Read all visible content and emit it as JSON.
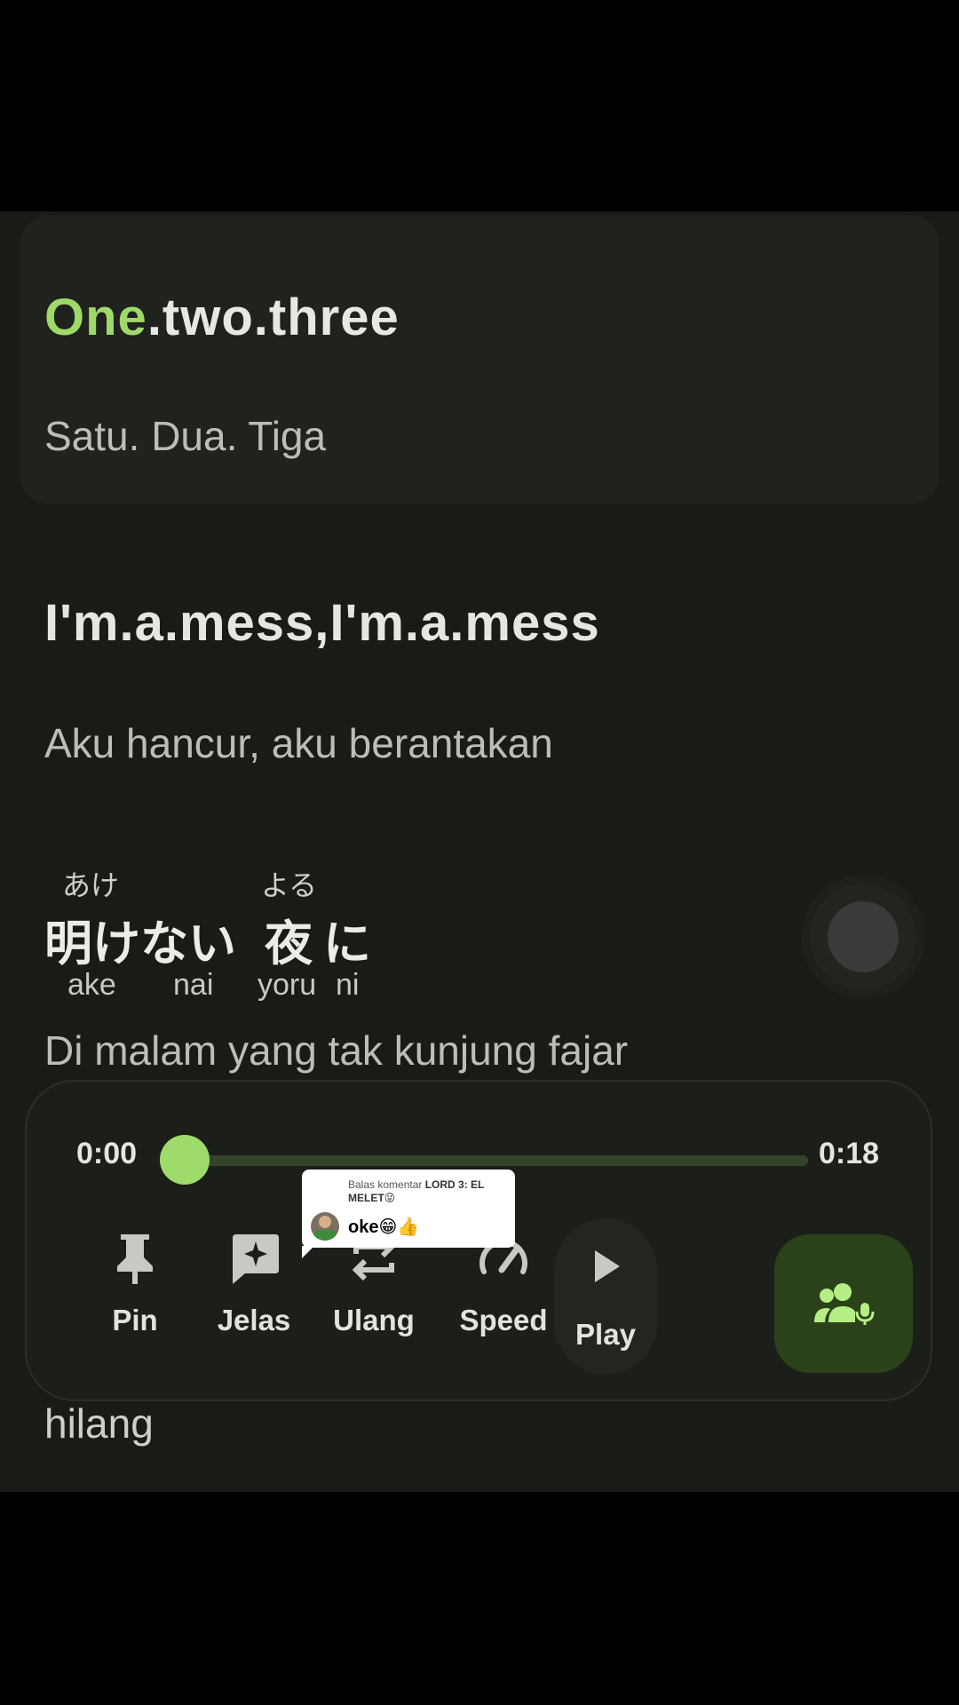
{
  "lyrics": {
    "line1": {
      "highlight": "One",
      "rest": ".two.three",
      "translation": "Satu. Dua. Tiga"
    },
    "line2": {
      "text": "I'm.a.mess,I'm.a.mess",
      "translation": "Aku hancur, aku berantakan"
    },
    "line3": {
      "tokens": [
        {
          "furigana": "あけ",
          "kanji": "明けない",
          "romaji": "ake"
        },
        {
          "furigana": "",
          "kanji": "",
          "romaji": "nai"
        },
        {
          "furigana": "よる",
          "kanji": "夜",
          "romaji": "yoru"
        },
        {
          "furigana": "",
          "kanji": "に",
          "romaji": "ni"
        }
      ],
      "translation": "Di malam yang tak kunjung fajar"
    },
    "line4": {
      "translation": "hilang"
    }
  },
  "player": {
    "current_time": "0:00",
    "total_time": "0:18",
    "progress": 0.0,
    "accent_color": "#9edb6a",
    "controls": {
      "pin": {
        "label": "Pin",
        "icon": "pin-icon"
      },
      "explain": {
        "label": "Jelas",
        "icon": "sparkle-comment-icon"
      },
      "repeat": {
        "label": "Ulang",
        "icon": "repeat-icon"
      },
      "speed": {
        "label": "Speed",
        "icon": "speedometer-icon"
      },
      "play": {
        "label": "Play",
        "icon": "play-icon"
      },
      "voice": {
        "icon": "people-mic-icon"
      }
    }
  },
  "comment_reply": {
    "prefix": "Balas komentar",
    "author": "LORD 3: EL MELET😜",
    "message": "oke😁👍"
  }
}
